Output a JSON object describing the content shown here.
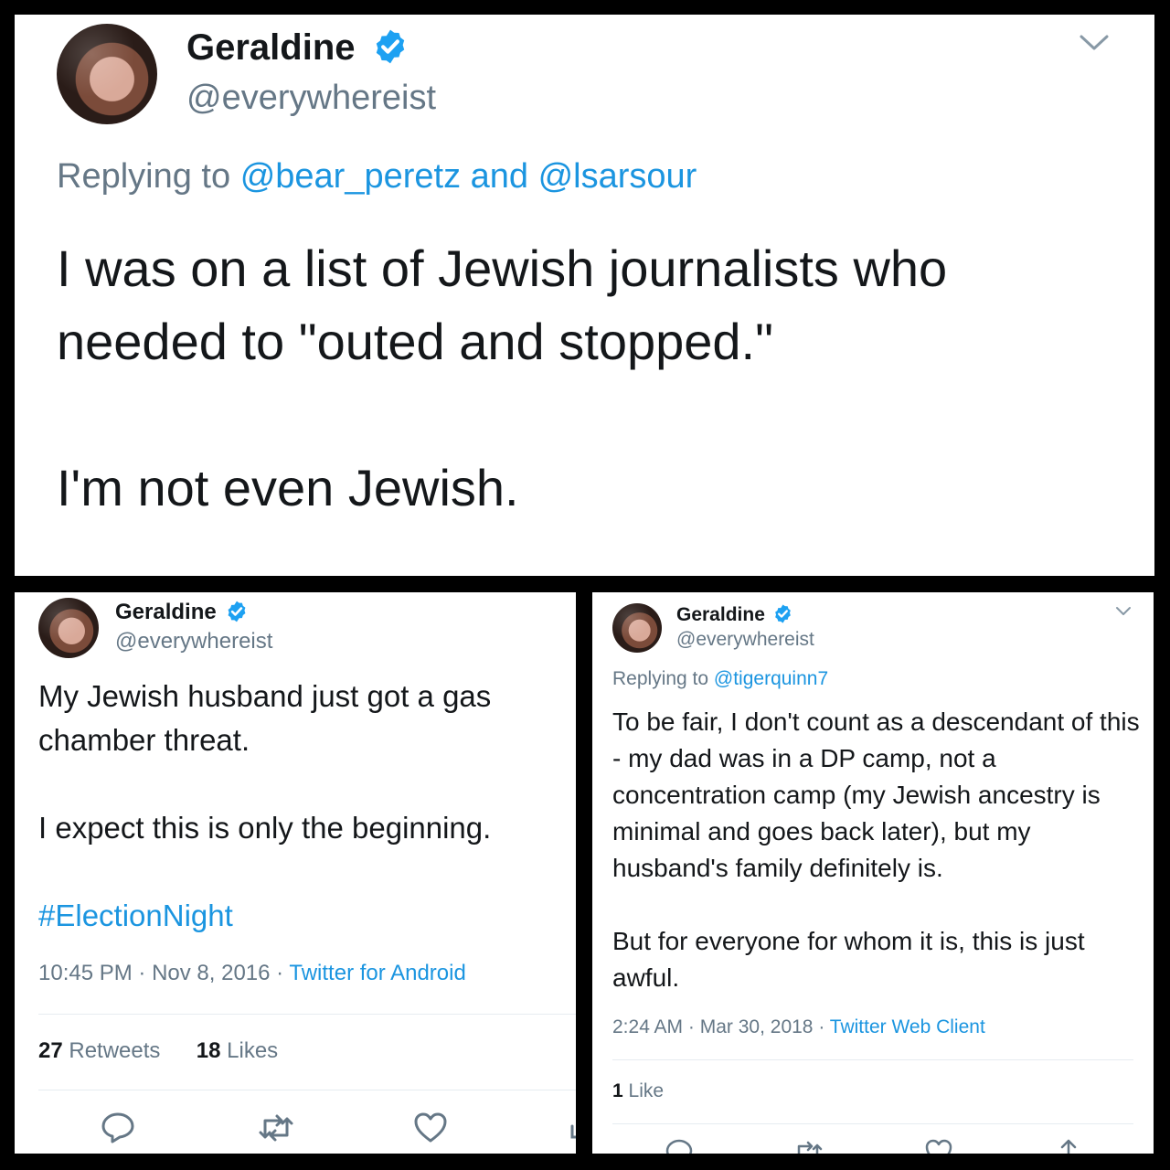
{
  "tweet_top": {
    "name": "Geraldine",
    "handle": "@everywhereist",
    "replying_prefix": "Replying to",
    "reply_handle_1": "@bear_peretz",
    "reply_conj": "and",
    "reply_handle_2": "@lsarsour",
    "paragraphs": [
      "I was on a list of Jewish journalists who needed to \"outed and stopped.\"",
      "I'm not even Jewish."
    ]
  },
  "tweet_left": {
    "name": "Geraldine",
    "handle": "@everywhereist",
    "paragraphs": [
      "My Jewish husband just got a gas chamber threat.",
      "I expect this is only the beginning."
    ],
    "hashtag": "#ElectionNight",
    "time": "10:45 PM",
    "date": "Nov 8, 2016",
    "source": "Twitter for Android",
    "retweets_count": "27",
    "retweets_label": "Retweets",
    "likes_count": "18",
    "likes_label": "Likes"
  },
  "tweet_right": {
    "name": "Geraldine",
    "handle": "@everywhereist",
    "replying_prefix": "Replying to",
    "reply_handle_1": "@tigerquinn7",
    "paragraphs": [
      "To be fair, I don't count as a descendant of this - my dad was in a DP camp, not a concentration camp (my Jewish ancestry is minimal and goes back later), but my husband's family definitely is.",
      "But for everyone for whom it is, this is just awful."
    ],
    "time": "2:24 AM",
    "date": "Mar 30, 2018",
    "source": "Twitter Web Client",
    "likes_count": "1",
    "likes_label": "Like"
  },
  "colors": {
    "background": "#000000",
    "link": "#1b95e0",
    "verified": "#1da1f2",
    "text": "#14171a",
    "secondary": "#657786"
  },
  "icons": [
    "verified-badge-icon",
    "chevron-down-icon",
    "reply-icon",
    "retweet-icon",
    "like-icon",
    "share-icon"
  ]
}
